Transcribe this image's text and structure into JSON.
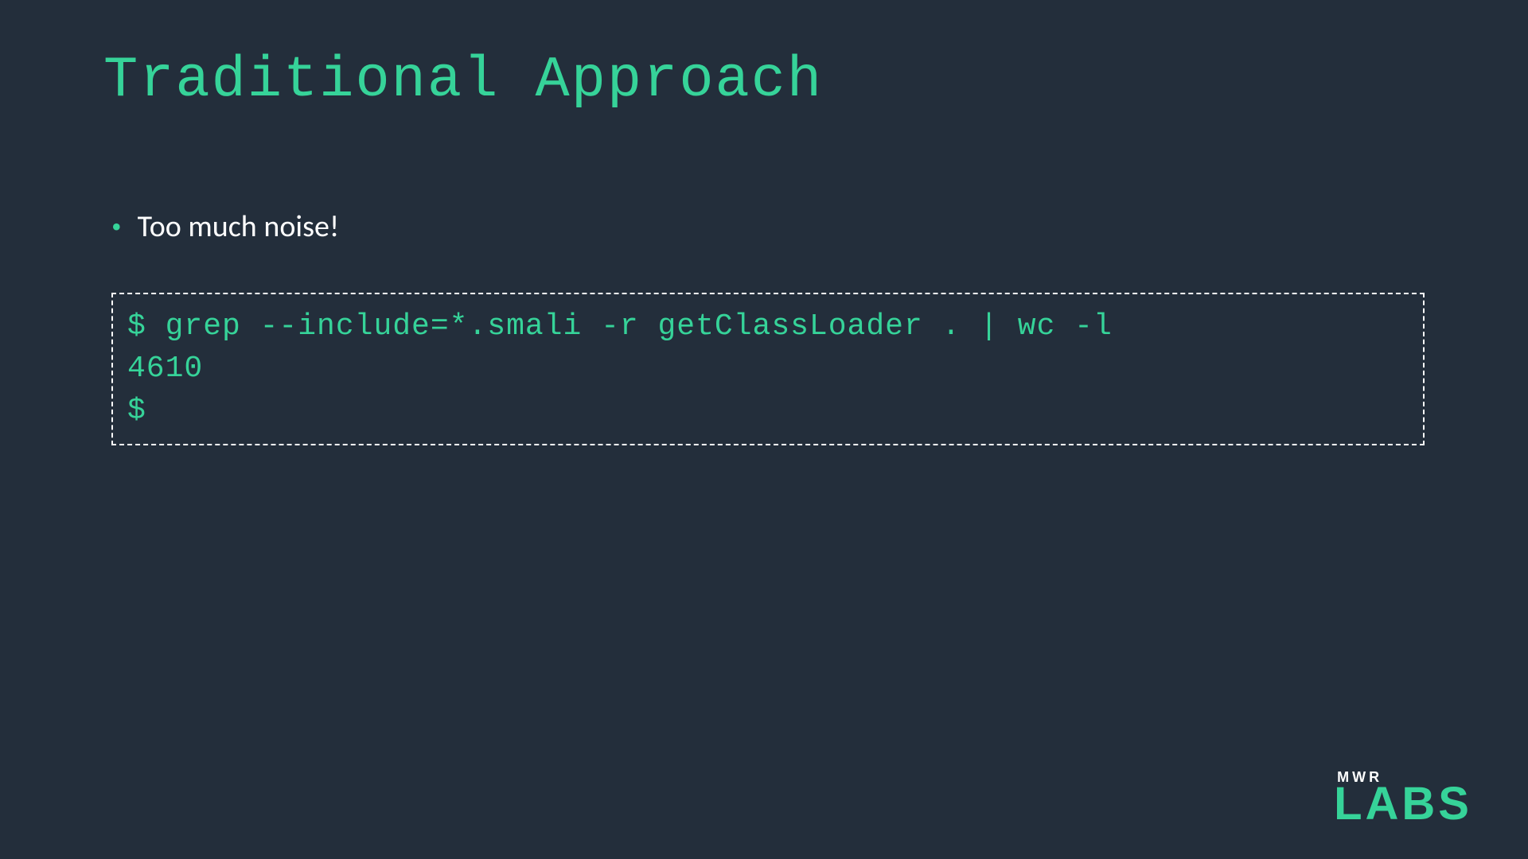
{
  "title": "Traditional Approach",
  "bullets": [
    "Too much noise!"
  ],
  "code": {
    "line1": "$ grep --include=*.smali -r getClassLoader . | wc -l",
    "line2": "4610",
    "line3": "$"
  },
  "logo": {
    "top": "MWR",
    "bottom": "LABS"
  }
}
